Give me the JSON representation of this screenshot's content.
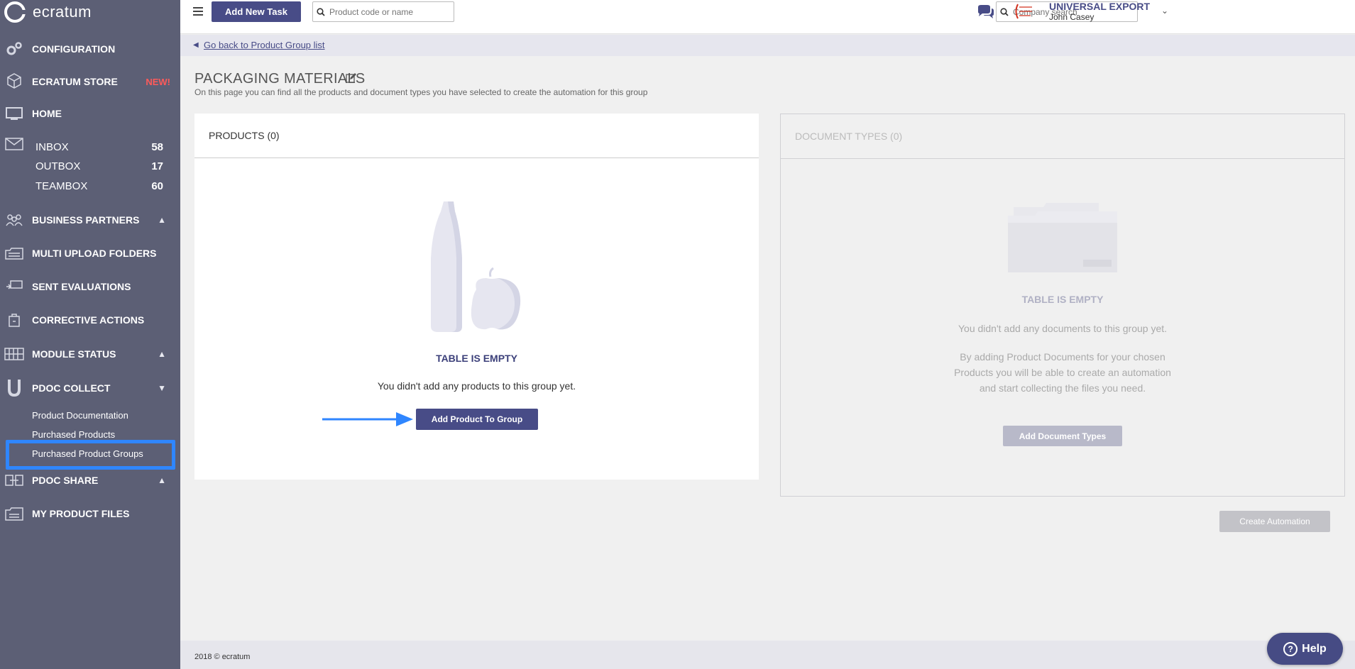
{
  "app": {
    "logo_text": "ecratum"
  },
  "sidebar": {
    "items": [
      {
        "label": "CONFIGURATION",
        "icon": "gears-icon"
      },
      {
        "label": "ECRATUM STORE",
        "badge": "NEW!",
        "icon": "cubes-icon"
      },
      {
        "label": "HOME",
        "icon": "monitor-icon"
      },
      {
        "label": "BUSINESS PARTNERS",
        "icon": "people-icon"
      },
      {
        "label": "MULTI UPLOAD FOLDERS",
        "icon": "folders-icon"
      },
      {
        "label": "SENT EVALUATIONS",
        "icon": "evaluation-icon"
      },
      {
        "label": "CORRECTIVE ACTIONS",
        "icon": "toolbox-icon"
      },
      {
        "label": "MODULE STATUS",
        "icon": "grid-icon"
      },
      {
        "label": "PDOC COLLECT",
        "icon": "magnet-icon"
      },
      {
        "label": "PDOC SHARE",
        "icon": "share-icon"
      },
      {
        "label": "MY PRODUCT FILES",
        "icon": "files-icon"
      }
    ],
    "mailboxes": [
      {
        "label": "INBOX",
        "count": "58"
      },
      {
        "label": "OUTBOX",
        "count": "17"
      },
      {
        "label": "TEAMBOX",
        "count": "60"
      }
    ],
    "pdoc_collect_children": [
      {
        "label": "Product Documentation"
      },
      {
        "label": "Purchased Products"
      },
      {
        "label": "Purchased Product Groups"
      }
    ]
  },
  "topbar": {
    "add_task_label": "Add New Task",
    "product_search_placeholder": "Product code or name",
    "company_search_placeholder": "Company search",
    "company_name": "UNIVERSAL EXPORT",
    "user_name": "John Casey"
  },
  "breadcrumb": {
    "back_label": "Go back to Product Group list"
  },
  "page": {
    "title": "PACKAGING MATERIALS",
    "subtitle": "On this page you can find all the products and document types you have selected to create the automation for this group"
  },
  "products_panel": {
    "title": "PRODUCTS (0)",
    "empty_title": "TABLE IS EMPTY",
    "empty_text": "You didn't add any products to this group yet.",
    "add_button": "Add Product To Group"
  },
  "documents_panel": {
    "title": "DOCUMENT TYPES (0)",
    "empty_title": "TABLE IS EMPTY",
    "empty_text_1": "You didn't add any documents to this group yet.",
    "empty_text_2": "By adding Product Documents for your chosen Products you will be able to create an automation and start collecting the files you need.",
    "add_button": "Add Document Types"
  },
  "create_automation_label": "Create Automation",
  "footer": {
    "copyright": "2018 © ecratum"
  },
  "help_label": "Help",
  "colors": {
    "sidebar_bg": "#5c5f75",
    "accent": "#484c87",
    "new_badge": "#ff5a5a",
    "highlight": "#2f86ff"
  }
}
